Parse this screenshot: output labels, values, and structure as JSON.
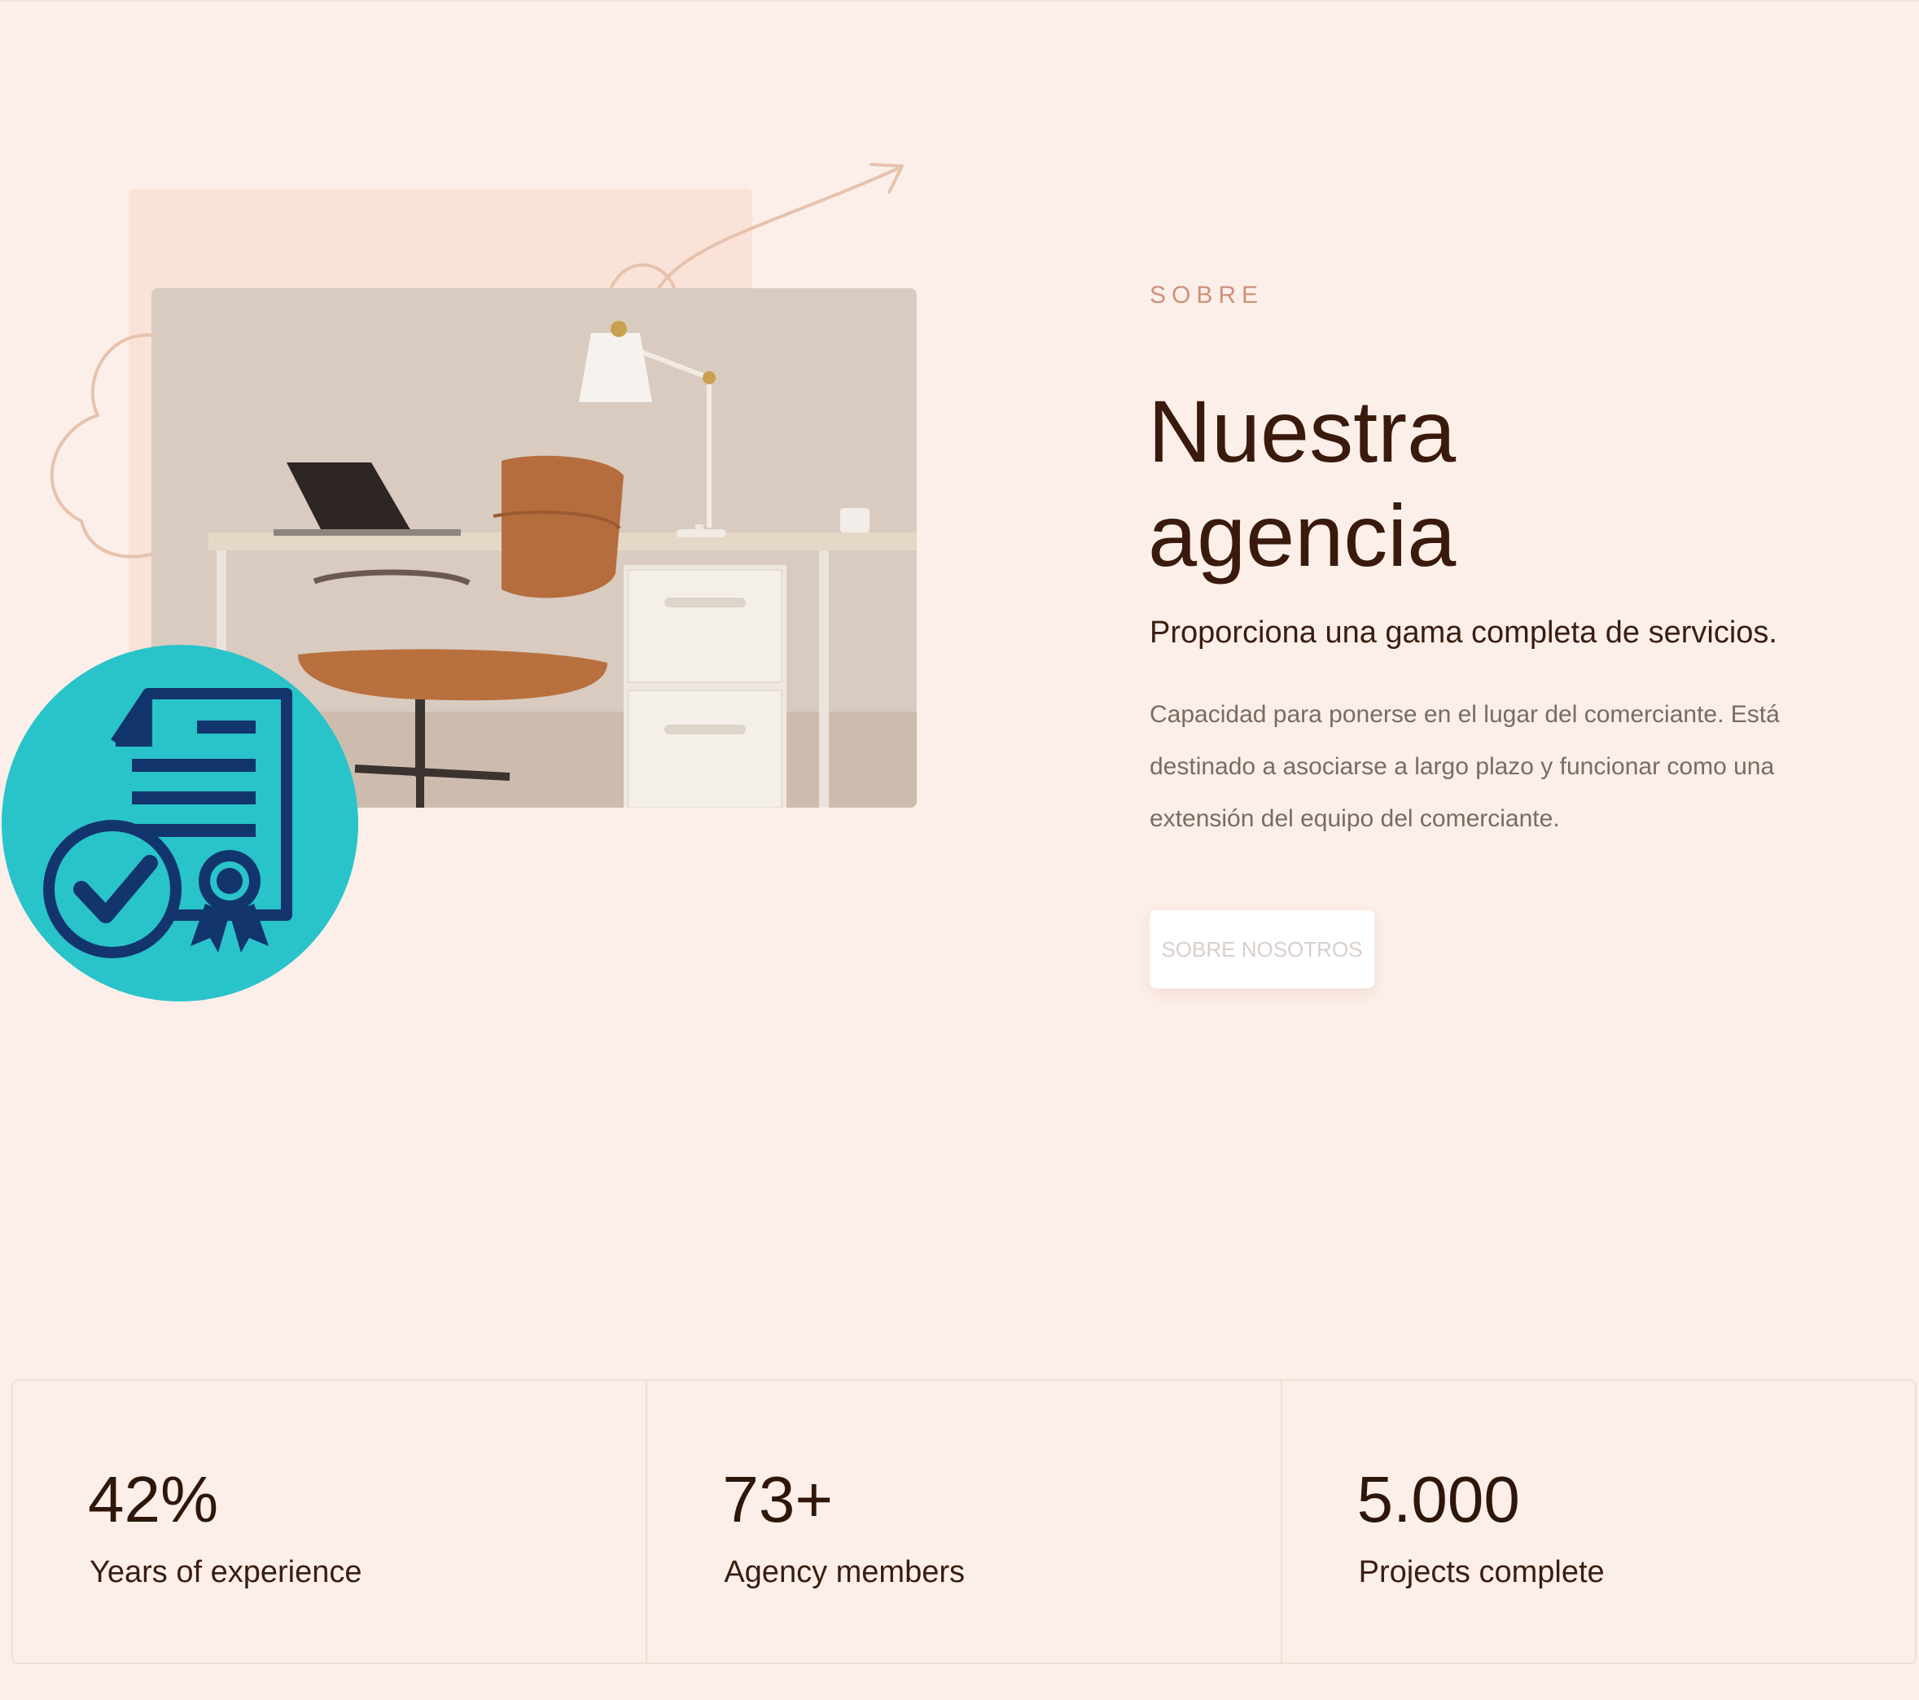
{
  "about": {
    "eyebrow": "SOBRE",
    "title_line1": "Nuestra",
    "title_line2": "agencia",
    "lead": "Proporciona una gama completa de servicios.",
    "body": "Capacidad para ponerse en el lugar del comerciante. Está destinado a asociarse a largo plazo y funcionar como una extensión del equipo del comerciante.",
    "cta_label": "SOBRE NOSOTROS"
  },
  "media": {
    "photo_icon": "office-photo",
    "badge_icon": "certificate-check-icon",
    "decoration_icon": "squiggle-arrow-icon"
  },
  "stats": [
    {
      "value": "42%",
      "label": "Years of experience"
    },
    {
      "value": "73+",
      "label": "Agency members"
    },
    {
      "value": "5.000",
      "label": "Projects complete"
    }
  ],
  "colors": {
    "background": "#fcefe9",
    "accent": "#d0907a",
    "heading": "#3a1a0c",
    "badge": "#29c3ca",
    "badge_icon": "#12356e"
  }
}
